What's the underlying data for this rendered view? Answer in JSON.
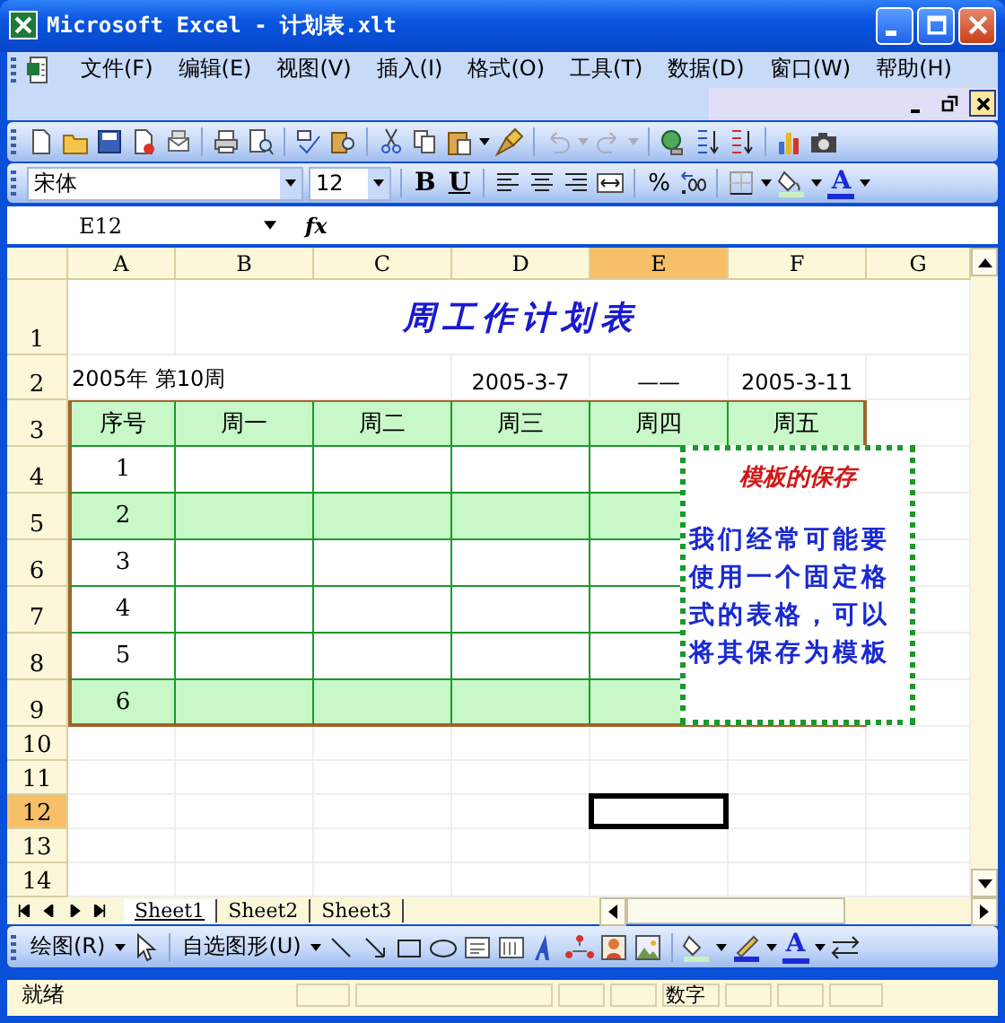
{
  "window": {
    "title": "Microsoft Excel - 计划表.xlt"
  },
  "menu_bar": {
    "items": [
      {
        "label": "文件(F)"
      },
      {
        "label": "编辑(E)"
      },
      {
        "label": "视图(V)"
      },
      {
        "label": "插入(I)"
      },
      {
        "label": "格式(O)"
      },
      {
        "label": "工具(T)"
      },
      {
        "label": "数据(D)"
      },
      {
        "label": "窗口(W)"
      },
      {
        "label": "帮助(H)"
      }
    ]
  },
  "formatting": {
    "font": "宋体",
    "size": "12",
    "bold": "B",
    "underline": "U",
    "percent": "%",
    "font_color": "A"
  },
  "formula_bar": {
    "name_box": "E12",
    "fx": "fx"
  },
  "columns": [
    {
      "label": "A",
      "selected": false
    },
    {
      "label": "B",
      "selected": false
    },
    {
      "label": "C",
      "selected": false
    },
    {
      "label": "D",
      "selected": false
    },
    {
      "label": "E",
      "selected": true
    },
    {
      "label": "F",
      "selected": false
    },
    {
      "label": "G",
      "selected": false
    }
  ],
  "rows": [
    {
      "kind": "title",
      "header": "1",
      "selected": false,
      "text": "周工作计划表"
    },
    {
      "kind": "info",
      "header": "2",
      "selected": false,
      "cells": [
        "2005年  第10周",
        "2005-3-7",
        "——",
        "2005-3-11"
      ]
    },
    {
      "kind": "table_head",
      "header": "3",
      "selected": false,
      "cells": [
        "序号",
        "周一",
        "周二",
        "周三",
        "周四",
        "周五"
      ]
    },
    {
      "kind": "table_row",
      "header": "4",
      "selected": false,
      "number": "1",
      "shaded": false
    },
    {
      "kind": "table_row",
      "header": "5",
      "selected": false,
      "number": "2",
      "shaded": true
    },
    {
      "kind": "table_row",
      "header": "6",
      "selected": false,
      "number": "3",
      "shaded": false
    },
    {
      "kind": "table_row",
      "header": "7",
      "selected": false,
      "number": "4",
      "shaded": false
    },
    {
      "kind": "table_row",
      "header": "8",
      "selected": false,
      "number": "5",
      "shaded": false
    },
    {
      "kind": "table_row",
      "header": "9",
      "selected": false,
      "number": "6",
      "shaded": true
    },
    {
      "kind": "blank",
      "header": "10",
      "selected": false
    },
    {
      "kind": "blank",
      "header": "11",
      "selected": false
    },
    {
      "kind": "blank",
      "header": "12",
      "selected": true
    },
    {
      "kind": "blank",
      "header": "13",
      "selected": false
    },
    {
      "kind": "blank",
      "header": "14",
      "selected": false
    }
  ],
  "callout": {
    "title": "模板的保存",
    "text": "我们经常可能要使用一个固定格式的表格，可以将其保存为模板"
  },
  "sheet_tabs": [
    {
      "label": "Sheet1",
      "selected": true
    },
    {
      "label": "Sheet2",
      "selected": false
    },
    {
      "label": "Sheet3",
      "selected": false
    }
  ],
  "drawing_toolbar": {
    "draw": "绘图(R)",
    "autoshapes": "自选图形(U)",
    "font_color": "A"
  },
  "status_bar": {
    "status": "就绪",
    "num": "数字"
  }
}
